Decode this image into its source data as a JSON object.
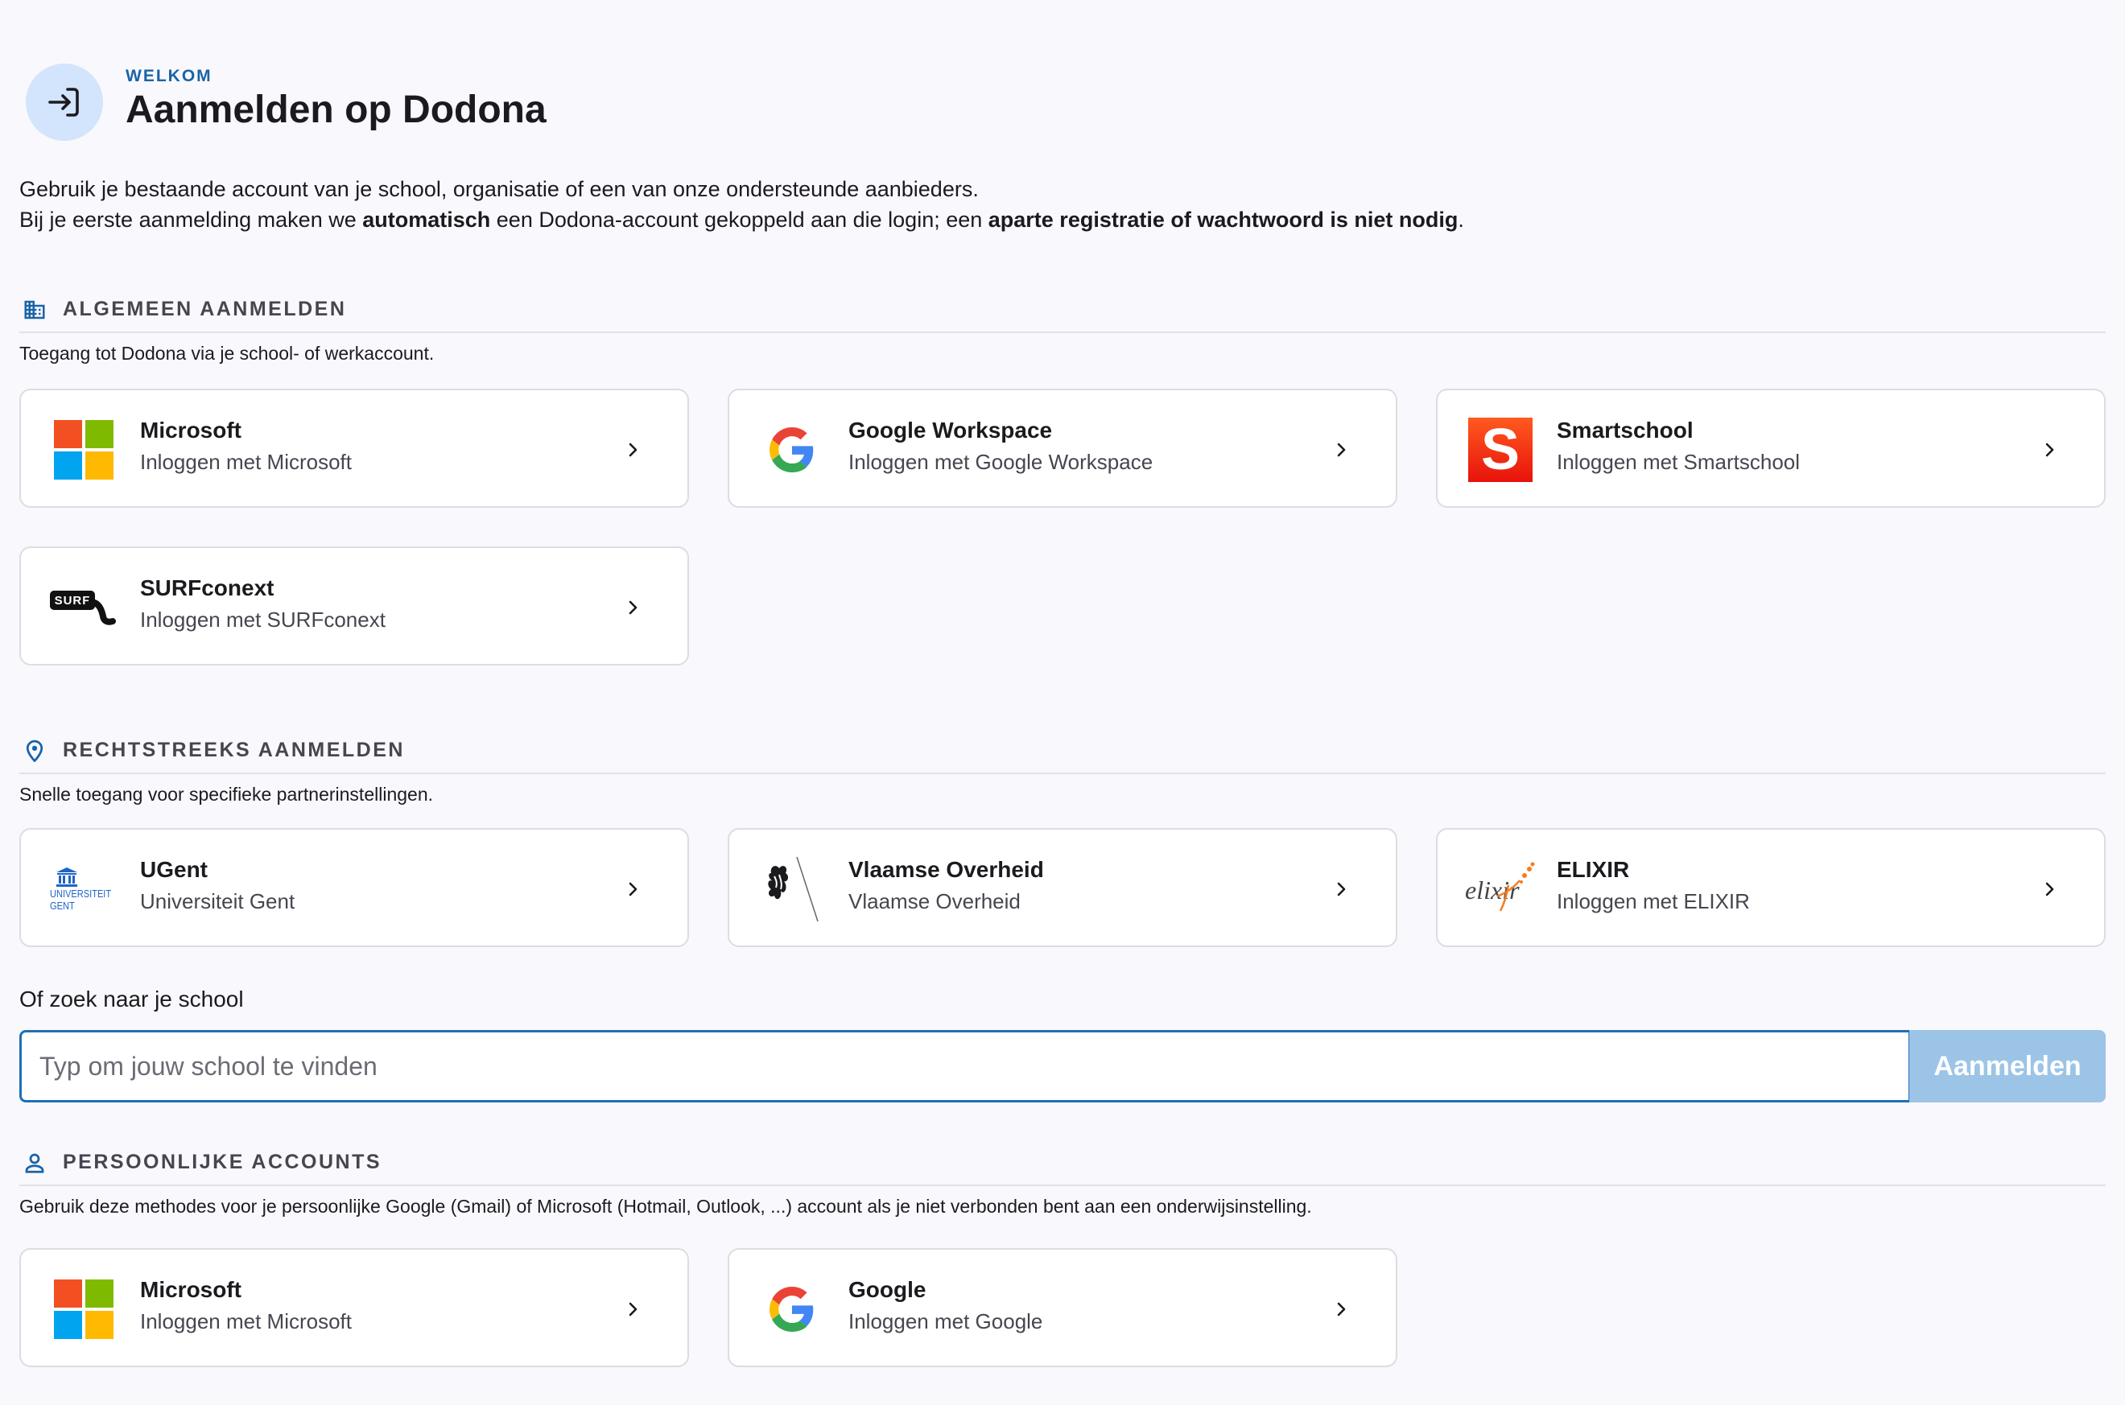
{
  "header": {
    "eyebrow": "WELKOM",
    "title": "Aanmelden op Dodona"
  },
  "intro": {
    "line1": "Gebruik je bestaande account van je school, organisatie of een van onze ondersteunde aanbieders.",
    "line2_pre": "Bij je eerste aanmelding maken we ",
    "line2_bold1": "automatisch",
    "line2_mid": " een Dodona-account gekoppeld aan die login; een ",
    "line2_bold2": "aparte registratie of wachtwoord is niet nodig",
    "line2_post": "."
  },
  "sections": {
    "general": {
      "title": "ALGEMEEN AANMELDEN",
      "description": "Toegang tot Dodona via je school- of werkaccount.",
      "cards": [
        {
          "title": "Microsoft",
          "subtitle": "Inloggen met Microsoft",
          "icon": "microsoft-logo"
        },
        {
          "title": "Google Workspace",
          "subtitle": "Inloggen met Google Workspace",
          "icon": "google-logo"
        },
        {
          "title": "Smartschool",
          "subtitle": "Inloggen met Smartschool",
          "icon": "smartschool-logo",
          "logo_text": "S"
        },
        {
          "title": "SURFconext",
          "subtitle": "Inloggen met SURFconext",
          "icon": "surf-logo",
          "logo_text": "SURF"
        }
      ]
    },
    "direct": {
      "title": "RECHTSTREEKS AANMELDEN",
      "description": "Snelle toegang voor specifieke partnerinstellingen.",
      "cards": [
        {
          "title": "UGent",
          "subtitle": "Universiteit Gent",
          "icon": "ugent-logo",
          "logo_text_1": "UNIVERSITEIT",
          "logo_text_2": "GENT"
        },
        {
          "title": "Vlaamse Overheid",
          "subtitle": "Vlaamse Overheid",
          "icon": "flemish-lion-logo"
        },
        {
          "title": "ELIXIR",
          "subtitle": "Inloggen met ELIXIR",
          "icon": "elixir-logo",
          "logo_text": "elixir"
        }
      ]
    },
    "personal": {
      "title": "PERSOONLIJKE ACCOUNTS",
      "description": "Gebruik deze methodes voor je persoonlijke Google (Gmail) of Microsoft (Hotmail, Outlook, ...) account als je niet verbonden bent aan een onderwijsinstelling.",
      "cards": [
        {
          "title": "Microsoft",
          "subtitle": "Inloggen met Microsoft",
          "icon": "microsoft-logo"
        },
        {
          "title": "Google",
          "subtitle": "Inloggen met Google",
          "icon": "google-logo"
        }
      ]
    }
  },
  "search": {
    "label": "Of zoek naar je school",
    "placeholder": "Typ om jouw school te vinden",
    "button": "Aanmelden"
  },
  "colors": {
    "accent": "#1a63a6",
    "button_disabled": "#9cc4e6",
    "header_icon_bg": "#d3e4fd"
  }
}
